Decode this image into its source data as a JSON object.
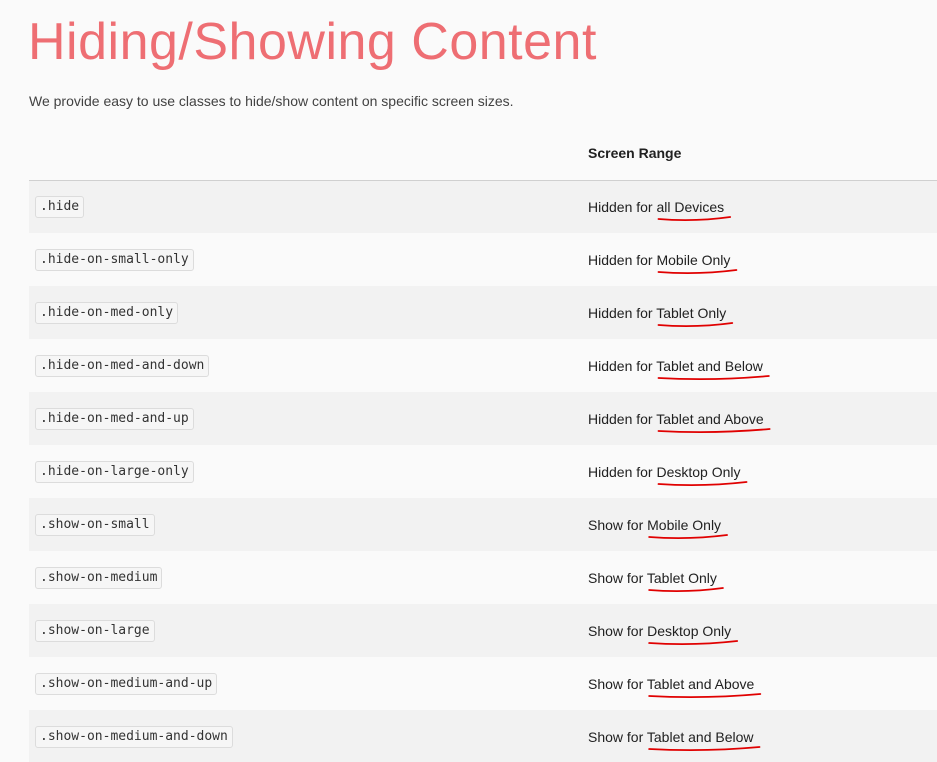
{
  "page": {
    "title": "Hiding/Showing Content",
    "intro": "We provide easy to use classes to hide/show content on specific screen sizes."
  },
  "table": {
    "headers": [
      "",
      "Screen Range"
    ],
    "rows": [
      {
        "class": ".hide",
        "range": "Hidden for all Devices"
      },
      {
        "class": ".hide-on-small-only",
        "range": "Hidden for Mobile Only"
      },
      {
        "class": ".hide-on-med-only",
        "range": "Hidden for Tablet Only"
      },
      {
        "class": ".hide-on-med-and-down",
        "range": "Hidden for Tablet and Below"
      },
      {
        "class": ".hide-on-med-and-up",
        "range": "Hidden for Tablet and Above"
      },
      {
        "class": ".hide-on-large-only",
        "range": "Hidden for Desktop Only"
      },
      {
        "class": ".show-on-small",
        "range": "Show for Mobile Only"
      },
      {
        "class": ".show-on-medium",
        "range": "Show for Tablet Only"
      },
      {
        "class": ".show-on-large",
        "range": "Show for Desktop Only"
      },
      {
        "class": ".show-on-medium-and-up",
        "range": "Show for Tablet and Above"
      },
      {
        "class": ".show-on-medium-and-down",
        "range": "Show for Tablet and Below"
      }
    ]
  },
  "colors": {
    "title": "#ee6e73",
    "annotation": "#e00000",
    "row_stripe": "#f2f2f2"
  }
}
